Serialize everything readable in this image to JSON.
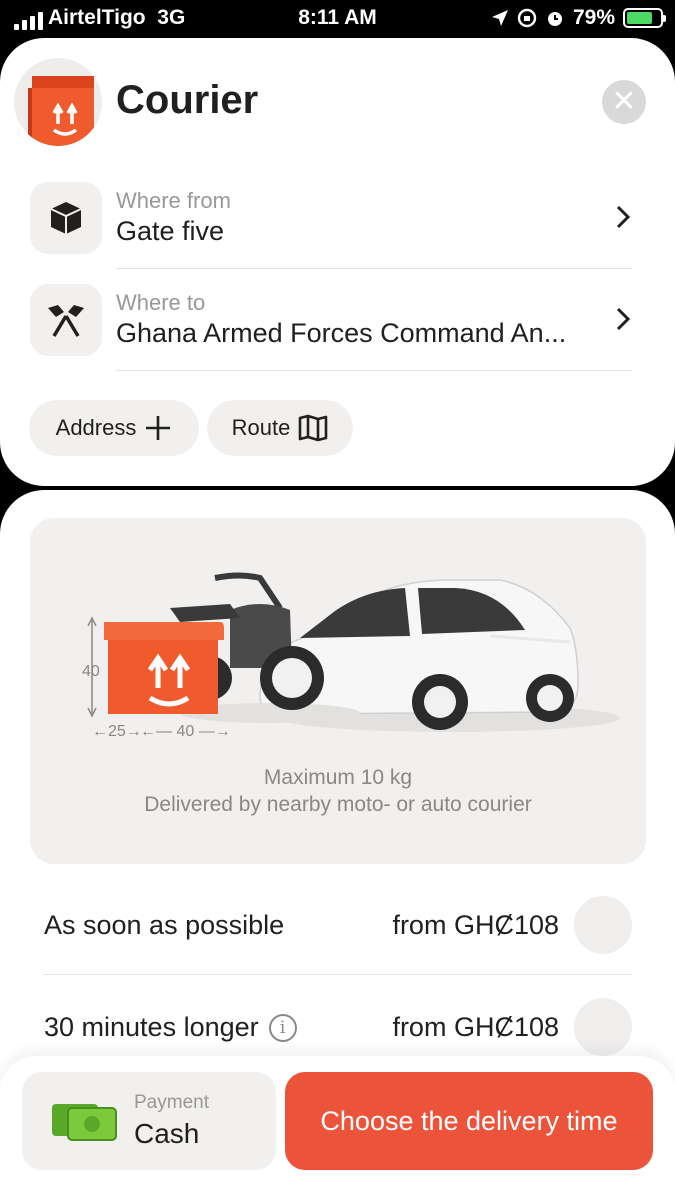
{
  "status_bar": {
    "carrier": "AirtelTigo",
    "network": "3G",
    "time": "8:11 AM",
    "battery": "79%",
    "battery_level": 0.79
  },
  "header": {
    "title": "Courier",
    "close_icon": "close-icon",
    "logo_icon": "courier-box-icon"
  },
  "route": {
    "from": {
      "label": "Where from",
      "value": "Gate five",
      "icon": "package-icon"
    },
    "to": {
      "label": "Where to",
      "value": "Ghana Armed Forces Command An...",
      "icon": "flags-icon"
    }
  },
  "actions": {
    "address_label": "Address",
    "route_label": "Route"
  },
  "promo": {
    "box_height": "40",
    "box_depth": "25",
    "box_width": "40",
    "max_weight": "Maximum 10 kg",
    "delivered_by": "Delivered by nearby moto- or auto courier"
  },
  "tariffs": [
    {
      "name": "As soon as possible",
      "price": "from GHȻ108"
    },
    {
      "name": "30 minutes longer",
      "price": "from GHȻ108"
    }
  ],
  "footer": {
    "payment_label": "Payment",
    "payment_value": "Cash",
    "cta_label": "Choose the delivery time"
  },
  "colors": {
    "accent": "#ec533b",
    "box_orange": "#ef5b2c",
    "battery_green": "#4cd964"
  }
}
